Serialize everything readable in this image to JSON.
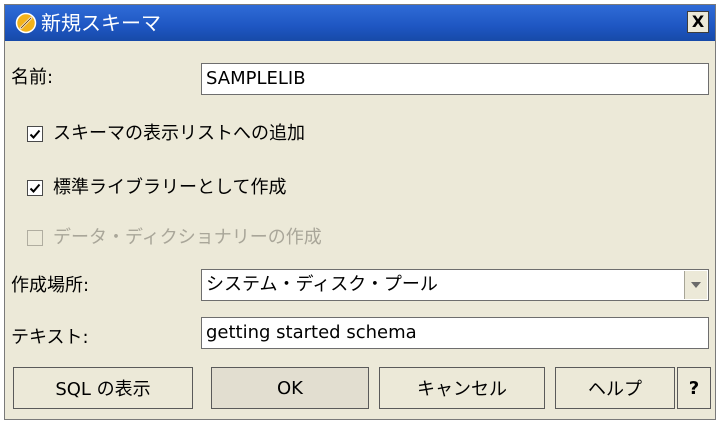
{
  "window": {
    "title": "新規スキーマ",
    "close_label": "X"
  },
  "form": {
    "name_label": "名前:",
    "name_value": "SAMPLELIB",
    "checkboxes": [
      {
        "label": "スキーマの表示リストへの追加",
        "checked": true,
        "enabled": true
      },
      {
        "label": "標準ライブラリーとして作成",
        "checked": true,
        "enabled": true
      },
      {
        "label": "データ・ディクショナリーの作成",
        "checked": false,
        "enabled": false
      }
    ],
    "location_label": "作成場所:",
    "location_value": "システム・ディスク・プール",
    "text_label": "テキスト:",
    "text_value": "getting started schema"
  },
  "buttons": {
    "show_sql": "SQL の表示",
    "ok": "OK",
    "cancel": "キャンセル",
    "help": "ヘルプ",
    "whats_this": "?"
  },
  "colors": {
    "titlebar": "#1e56c2",
    "dialog_bg": "#ece9d8",
    "disabled_text": "#a9a699"
  }
}
